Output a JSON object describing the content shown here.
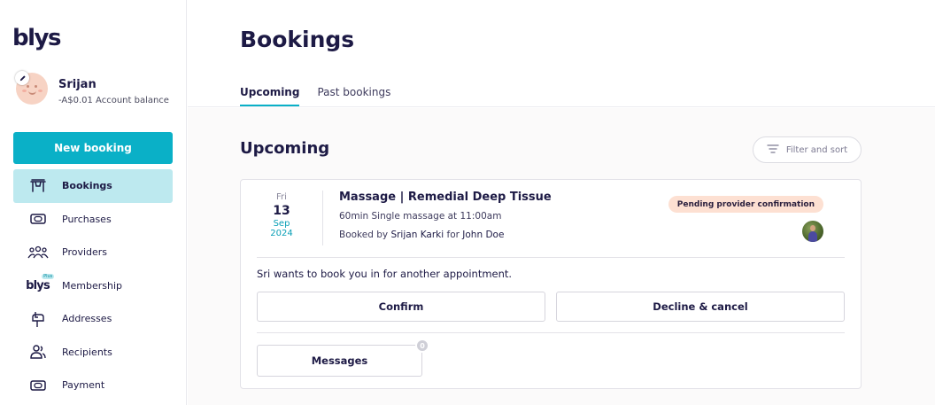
{
  "app": {
    "logo_text": "blys"
  },
  "user": {
    "name": "Srijan",
    "balance": "-A$0.01 Account balance"
  },
  "sidebar": {
    "new_booking_label": "New booking",
    "items": [
      {
        "label": "Bookings",
        "icon": "bookings-icon",
        "active": true
      },
      {
        "label": "Purchases",
        "icon": "purchases-icon",
        "active": false
      },
      {
        "label": "Providers",
        "icon": "providers-icon",
        "active": false
      },
      {
        "label": "Membership",
        "icon": "blys-plus-icon",
        "active": false,
        "icon_text": "blys",
        "icon_badge": "Plus"
      },
      {
        "label": "Addresses",
        "icon": "mailbox-icon",
        "active": false
      },
      {
        "label": "Recipients",
        "icon": "recipients-icon",
        "active": false
      },
      {
        "label": "Payment",
        "icon": "payment-icon",
        "active": false
      }
    ]
  },
  "header": {
    "title": "Bookings",
    "tabs": [
      {
        "label": "Upcoming",
        "active": true
      },
      {
        "label": "Past bookings",
        "active": false
      }
    ]
  },
  "main": {
    "section_title": "Upcoming",
    "filter_label": "Filter and sort",
    "booking": {
      "date": {
        "dow": "Fri",
        "day": "13",
        "month": "Sep",
        "year": "2024"
      },
      "title": "Massage | Remedial Deep Tissue",
      "detail": "60min Single massage at 11:00am",
      "booked_prefix": "Booked by",
      "booked_by": "Srijan Karki",
      "for_prefix": "for",
      "booked_for": "John Doe",
      "status": "Pending provider confirmation",
      "prompt": "Sri wants to book you in for another appointment.",
      "confirm_label": "Confirm",
      "decline_label": "Decline & cancel",
      "messages_label": "Messages",
      "messages_count": "0"
    }
  },
  "colors": {
    "accent": "#0ab0c7",
    "active_nav_bg": "#bde9ef",
    "text_dark": "#1d1a45",
    "status_badge_bg": "#fde0d2"
  }
}
